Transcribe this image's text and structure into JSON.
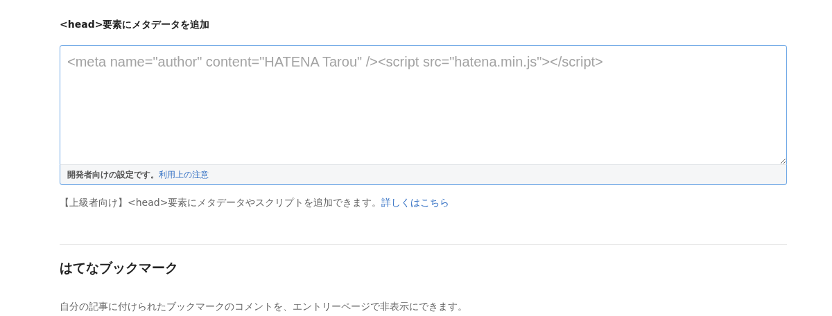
{
  "head_section": {
    "label": "<head>要素にメタデータを追加",
    "field": {
      "placeholder": "<meta name=\"author\" content=\"HATENA Tarou\" /><script src=\"hatena.min.js\"></script>"
    },
    "footer_note": {
      "text": "開発者向けの設定です。",
      "link": "利用上の注意"
    },
    "help": {
      "text": "【上級者向け】<head>要素にメタデータやスクリプトを追加できます。",
      "link": "詳しくはこちら"
    }
  },
  "bookmark_section": {
    "heading": "はてなブックマーク",
    "description": "自分の記事に付けられたブックマークのコメントを、エントリーページで非表示にできます。"
  }
}
